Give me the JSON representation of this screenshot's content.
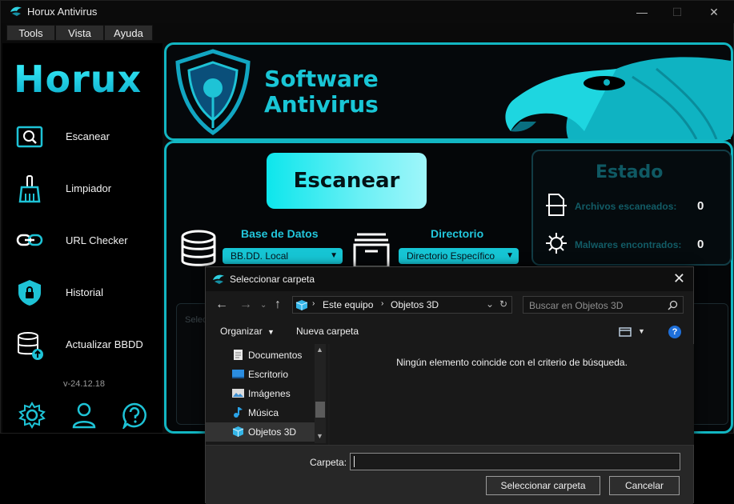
{
  "window": {
    "title": "Horux Antivirus",
    "controls": [
      "—",
      "☐",
      "✕"
    ]
  },
  "menu": [
    "Tools",
    "Vista",
    "Ayuda"
  ],
  "sidebar": {
    "brand": "Horux",
    "items": [
      {
        "label": "Escanear",
        "icon": "scan-icon"
      },
      {
        "label": "Limpiador",
        "icon": "broom-icon"
      },
      {
        "label": "URL Checker",
        "icon": "link-icon"
      },
      {
        "label": "Historial",
        "icon": "shield-lock-icon"
      },
      {
        "label": "Actualizar BBDD",
        "icon": "database-update-icon"
      }
    ],
    "version": "v-24.12.18"
  },
  "header": {
    "title_line1": "Software",
    "title_line2": "Antivirus"
  },
  "main": {
    "scan_button": "Escanear",
    "database": {
      "label": "Base de Datos",
      "selected": "BB.DD. Local"
    },
    "directory": {
      "label": "Directorio",
      "selected": "Directorio Específico"
    },
    "log_placeholder": "Selecc",
    "status": {
      "title": "Estado",
      "files_scanned_label": "Archivos escaneados:",
      "files_scanned_value": "0",
      "malware_found_label": "Malwares encontrados:",
      "malware_found_value": "0"
    }
  },
  "dialog": {
    "title": "Seleccionar carpeta",
    "breadcrumb": [
      "Este equipo",
      "Objetos 3D"
    ],
    "search_placeholder": "Buscar en Objetos 3D",
    "toolbar": {
      "organize": "Organizar",
      "new_folder": "Nueva carpeta"
    },
    "nav_items": [
      "Documentos",
      "Escritorio",
      "Imágenes",
      "Música",
      "Objetos 3D"
    ],
    "empty_message": "Ningún elemento coincide con el criterio de búsqueda.",
    "folder_label": "Carpeta:",
    "folder_value": "",
    "select_button": "Seleccionar carpeta",
    "cancel_button": "Cancelar"
  },
  "colors": {
    "accent": "#12b6c2",
    "cyan_button": "#0de6ec",
    "status_dim": "#125c66"
  }
}
